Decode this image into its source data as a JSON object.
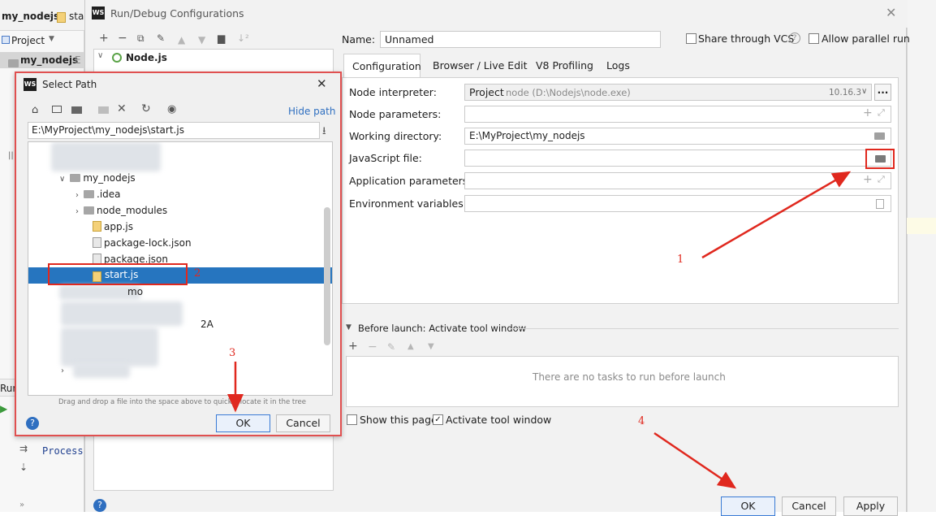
{
  "ide": {
    "breadcrumb_project": "my_nodejs",
    "breadcrumb_file_partial": "star",
    "project_tab": "Project",
    "project_root": "my_nodejs",
    "project_root_suffix": "E",
    "run_label": "Run:",
    "process_label": "Process"
  },
  "run_debug": {
    "title": "Run/Debug Configurations",
    "tree_node_nodejs": "Node.js",
    "name_label": "Name:",
    "name_value": "Unnamed",
    "share_label": "Share through VCS",
    "parallel_label": "Allow parallel run",
    "tabs": [
      "Configuration",
      "Browser / Live Edit",
      "V8 Profiling",
      "Logs"
    ],
    "fields": {
      "node_interpreter_label": "Node interpreter:",
      "node_interpreter_project": "Project",
      "node_interpreter_path": "node (D:\\Nodejs\\node.exe)",
      "node_interpreter_version": "10.16.3",
      "node_params_label": "Node parameters:",
      "working_dir_label": "Working directory:",
      "working_dir_value": "E:\\MyProject\\my_nodejs",
      "js_file_label": "JavaScript file:",
      "app_params_label": "Application parameters:",
      "env_vars_label": "Environment variables:"
    },
    "before_launch_label": "Before launch: Activate tool window",
    "no_tasks": "There are no tasks to run before launch",
    "show_page_label": "Show this page",
    "activate_tool_label": "Activate tool window",
    "ok": "OK",
    "cancel": "Cancel",
    "apply": "Apply",
    "ellipsis": "..."
  },
  "select_path": {
    "title": "Select Path",
    "hide_path": "Hide path",
    "path_value": "E:\\MyProject\\my_nodejs\\start.js",
    "tree": {
      "my_nodejs": "my_nodejs",
      "idea": ".idea",
      "node_modules": "node_modules",
      "app_js": "app.js",
      "package_lock": "package-lock.json",
      "package_json": "package.json",
      "start_js": "start.js",
      "partial_mo": "mo",
      "partial_2a": "2A"
    },
    "hint": "Drag and drop a file into the space above to quickly locate it in the tree",
    "ok": "OK",
    "cancel": "Cancel"
  },
  "annotations": [
    "1",
    "2",
    "3",
    "4"
  ],
  "colors": {
    "selection": "#2675bf",
    "annotation_red": "#e0281e",
    "default_button_border": "#3a7bd5"
  }
}
